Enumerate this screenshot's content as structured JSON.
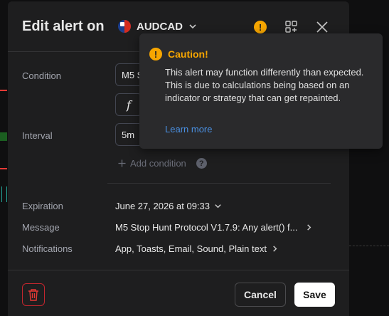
{
  "dialog": {
    "title": "Edit alert on",
    "symbol": "AUDCAD"
  },
  "form": {
    "condition_label": "Condition",
    "condition_value": "M5 S",
    "interval_label": "Interval",
    "interval_value": "5m",
    "add_condition": "Add condition",
    "function_icon_glyph": "f",
    "help_glyph": "?"
  },
  "details": {
    "expiration_label": "Expiration",
    "expiration_value": "June 27, 2026 at 09:33",
    "message_label": "Message",
    "message_value": "M5 Stop Hunt Protocol V1.7.9: Any alert() f...",
    "notifications_label": "Notifications",
    "notifications_value": "App, Toasts, Email, Sound, Plain text"
  },
  "footer": {
    "cancel_label": "Cancel",
    "save_label": "Save"
  },
  "tooltip": {
    "title": "Caution!",
    "body": "This alert may function differently than expected. This is due to calculations being based on an indicator or strategy that can get repainted.",
    "link": "Learn more",
    "warn_glyph": "!"
  },
  "colors": {
    "accent_warning": "#f7a600",
    "link": "#4a90e2",
    "delete_red": "#c2262e",
    "dialog_bg": "#1e1e1f"
  },
  "icons": [
    "flag-icon",
    "chevron-down-icon",
    "warning-icon",
    "add-widget-icon",
    "close-icon",
    "function-icon",
    "plus-icon",
    "help-icon",
    "chevron-right-icon",
    "trash-icon"
  ]
}
